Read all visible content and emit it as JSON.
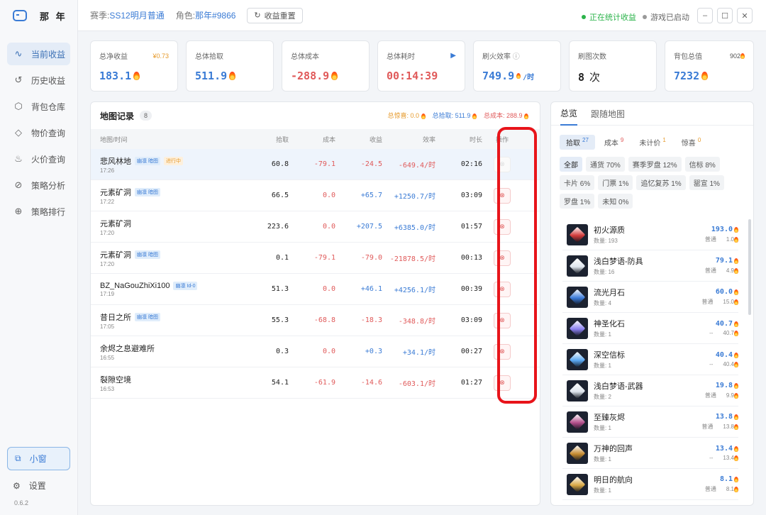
{
  "app": {
    "name": "那 年",
    "version": "0.6.2"
  },
  "sidebar": {
    "items": [
      {
        "label": "当前收益",
        "icon": "pulse-icon",
        "glyph": "∿",
        "active": true
      },
      {
        "label": "历史收益",
        "icon": "history-icon",
        "glyph": "↺",
        "active": false
      },
      {
        "label": "背包仓库",
        "icon": "box-icon",
        "glyph": "⬡",
        "active": false
      },
      {
        "label": "物价查询",
        "icon": "tag-icon",
        "glyph": "◇",
        "active": false
      },
      {
        "label": "火价查询",
        "icon": "flame-icon",
        "glyph": "♨",
        "active": false
      },
      {
        "label": "策略分析",
        "icon": "compass-icon",
        "glyph": "⊘",
        "active": false
      },
      {
        "label": "策略排行",
        "icon": "globe-icon",
        "glyph": "⊕",
        "active": false
      }
    ],
    "mini_window": "小窗",
    "settings": "设置"
  },
  "topbar": {
    "season_label": "赛季:",
    "season_value": "SS12明月普通",
    "role_label": "角色:",
    "role_value": "那年#9866",
    "reset_label": "收益重置",
    "status_stats": "正在统计收益",
    "status_game": "游戏已启动"
  },
  "stats": {
    "net_income": {
      "title": "总净收益",
      "extra": "¥0.73",
      "value": "183.1"
    },
    "total_pickup": {
      "title": "总体拾取",
      "value": "511.9"
    },
    "total_cost": {
      "title": "总体成本",
      "value": "-288.9"
    },
    "total_time": {
      "title": "总体耗时",
      "value": "00:14:39"
    },
    "efficiency": {
      "title": "刷火效率",
      "value": "749.9",
      "unit": "/时"
    },
    "map_count": {
      "title": "刷图次数",
      "value": "8",
      "unit": "次"
    },
    "bag_value": {
      "title": "背包总值",
      "extra": "902",
      "value": "7232"
    }
  },
  "map_records": {
    "title": "地图记录",
    "count": "8",
    "summary": {
      "surprise": "总惊喜: 0.0",
      "pickup": "总拾取: 511.9",
      "cost": "总成本: 288.9"
    },
    "headers": {
      "map": "地图/时间",
      "pickup": "拾取",
      "cost": "成本",
      "income": "收益",
      "efficiency": "效率",
      "duration": "时长",
      "action": "操作"
    },
    "rows": [
      {
        "name": "悲风林地",
        "time": "17:26",
        "tags": [
          "幽凛 暗图",
          "进行中"
        ],
        "pickup": "60.8",
        "cost": "-79.1",
        "income": "-24.5",
        "eff": "-649.4/时",
        "dur": "02:16",
        "current": true
      },
      {
        "name": "元素矿洞",
        "time": "17:22",
        "tags": [
          "幽凛 暗图"
        ],
        "pickup": "66.5",
        "cost": "0.0",
        "income": "+65.7",
        "eff": "+1250.7/时",
        "dur": "03:09",
        "current": false
      },
      {
        "name": "元素矿洞",
        "time": "17:20",
        "tags": [],
        "pickup": "223.6",
        "cost": "0.0",
        "income": "+207.5",
        "eff": "+6385.0/时",
        "dur": "01:57",
        "current": false
      },
      {
        "name": "元素矿洞",
        "time": "17:20",
        "tags": [
          "幽凛 暗图"
        ],
        "pickup": "0.1",
        "cost": "-79.1",
        "income": "-79.0",
        "eff": "-21878.5/时",
        "dur": "00:13",
        "current": false
      },
      {
        "name": "BZ_NaGouZhiXi100",
        "time": "17:19",
        "tags": [
          "幽凛 Id-0"
        ],
        "pickup": "51.3",
        "cost": "0.0",
        "income": "+46.1",
        "eff": "+4256.1/时",
        "dur": "00:39",
        "current": false
      },
      {
        "name": "昔日之所",
        "time": "17:05",
        "tags": [
          "幽凛 暗图"
        ],
        "pickup": "55.3",
        "cost": "-68.8",
        "income": "-18.3",
        "eff": "-348.8/时",
        "dur": "03:09",
        "current": false
      },
      {
        "name": "余烬之息避难所",
        "time": "16:55",
        "tags": [],
        "pickup": "0.3",
        "cost": "0.0",
        "income": "+0.3",
        "eff": "+34.1/时",
        "dur": "00:27",
        "current": false
      },
      {
        "name": "裂隙空境",
        "time": "16:53",
        "tags": [],
        "pickup": "54.1",
        "cost": "-61.9",
        "income": "-14.6",
        "eff": "-603.1/时",
        "dur": "01:27",
        "current": false
      }
    ]
  },
  "overview": {
    "tabs": [
      "总览",
      "跟随地图"
    ],
    "subtabs": [
      {
        "label": "拾取",
        "count": "27",
        "color": "#3a7bd5"
      },
      {
        "label": "成本",
        "count": "9",
        "color": "#e05a5a"
      },
      {
        "label": "未计价",
        "count": "1",
        "color": "#e69a2b"
      },
      {
        "label": "惊喜",
        "count": "0",
        "color": "#e69a2b"
      }
    ],
    "filters": [
      "全部",
      "通货 70%",
      "赛季罗盘 12%",
      "信标 8%",
      "卡片 6%",
      "门票 1%",
      "追忆复苏 1%",
      "罂宣 1%",
      "罗盘 1%",
      "未知 0%"
    ],
    "items": [
      {
        "name": "初火源质",
        "qty": "数量: 193",
        "value": "193.0",
        "quality": "普通",
        "unit": "1.0",
        "color": "#d23a3a"
      },
      {
        "name": "浅白梦语-防具",
        "qty": "数量: 16",
        "value": "79.1",
        "quality": "普通",
        "unit": "4.9",
        "color": "#dfe6ee"
      },
      {
        "name": "流光月石",
        "qty": "数量: 4",
        "value": "60.0",
        "quality": "普通",
        "unit": "15.0",
        "color": "#3b7ad8"
      },
      {
        "name": "神圣化石",
        "qty": "数量: 1",
        "value": "40.7",
        "quality": "--",
        "unit": "40.7",
        "color": "#8a7ff0"
      },
      {
        "name": "深空信标",
        "qty": "数量: 1",
        "value": "40.4",
        "quality": "--",
        "unit": "40.4",
        "color": "#5aa7f2"
      },
      {
        "name": "浅白梦语-武器",
        "qty": "数量: 2",
        "value": "19.8",
        "quality": "普通",
        "unit": "9.9",
        "color": "#dfe6ee"
      },
      {
        "name": "至臻灰烬",
        "qty": "数量: 1",
        "value": "13.8",
        "quality": "普通",
        "unit": "13.8",
        "color": "#b24d8a"
      },
      {
        "name": "万神的回声",
        "qty": "数量: 1",
        "value": "13.4",
        "quality": "--",
        "unit": "13.4",
        "color": "#c58a2f"
      },
      {
        "name": "明日的航向",
        "qty": "数量: 1",
        "value": "8.1",
        "quality": "普通",
        "unit": "8.1",
        "color": "#d9a845"
      }
    ]
  },
  "colors": {
    "accent": "#3a7bd5",
    "negative": "#e05a5a",
    "positive": "#3a7bd5",
    "highlight": "#e8141a",
    "status_on": "#2bb34a",
    "status_off": "#999999"
  }
}
